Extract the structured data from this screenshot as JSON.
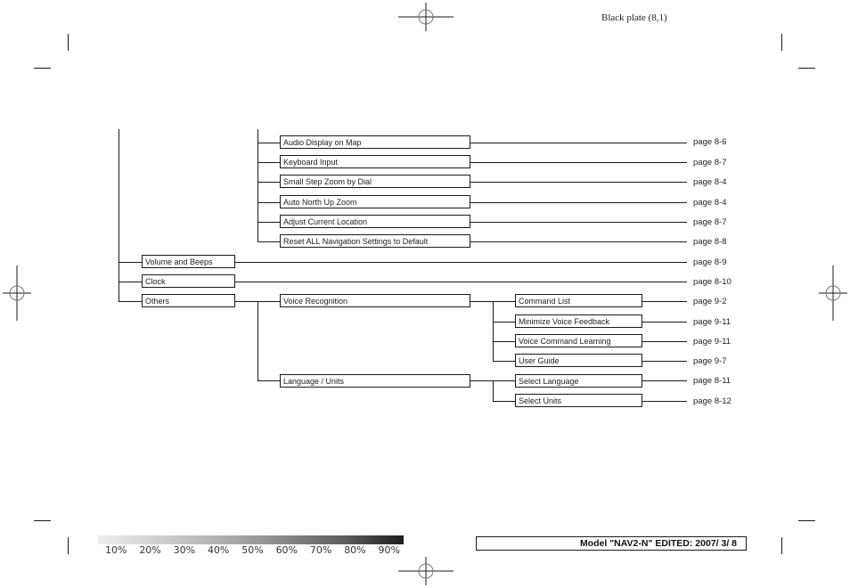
{
  "header": {
    "plate_label": "Black plate (8,1)"
  },
  "tree": {
    "navigation_children": [
      {
        "label": "Audio Display on Map",
        "page": "page 8-6"
      },
      {
        "label": "Keyboard Input",
        "page": "page 8-7"
      },
      {
        "label": "Small Step Zoom by Dial",
        "page": "page 8-4"
      },
      {
        "label": "Auto North Up Zoom",
        "page": "page 8-4"
      },
      {
        "label": "Adjust Current Location",
        "page": "page 8-7"
      },
      {
        "label": "Reset ALL Navigation Settings to Default",
        "page": "page 8-8"
      }
    ],
    "top_level": [
      {
        "label": "Volume and Beeps",
        "page": "page 8-9"
      },
      {
        "label": "Clock",
        "page": "page 8-10"
      },
      {
        "label": "Others",
        "page": ""
      }
    ],
    "others_children": [
      {
        "label": "Voice Recognition"
      },
      {
        "label": "Language / Units"
      }
    ],
    "voice_recognition_children": [
      {
        "label": "Command List",
        "page": "page 9-2"
      },
      {
        "label": "Minimize Voice Feedback",
        "page": "page 9-11"
      },
      {
        "label": "Voice Command Learning",
        "page": "page 9-11"
      },
      {
        "label": "User Guide",
        "page": "page 9-7"
      }
    ],
    "language_units_children": [
      {
        "label": "Select Language",
        "page": "page 8-11"
      },
      {
        "label": "Select Units",
        "page": "page 8-12"
      }
    ]
  },
  "footer": {
    "scale_labels": [
      "10%",
      "20%",
      "30%",
      "40%",
      "50%",
      "60%",
      "70%",
      "80%",
      "90%"
    ],
    "model_info": "Model \"NAV2-N\"  EDITED:  2007/ 3/ 8"
  }
}
